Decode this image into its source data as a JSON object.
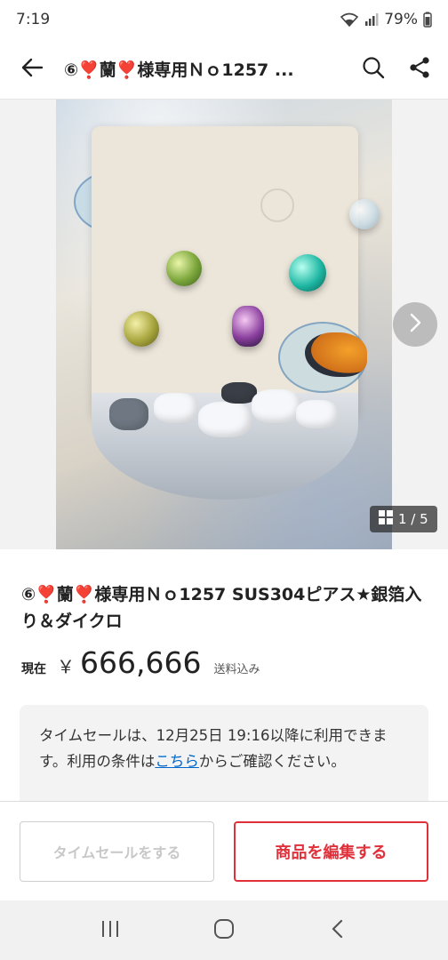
{
  "status_bar": {
    "time": "7:19",
    "battery": "79%",
    "icons": [
      "wifi-icon",
      "signal-icon"
    ]
  },
  "app_bar": {
    "title": "⑥❣️蘭❣️様専用Ｎｏ1257 ...",
    "icons": [
      "back-arrow-icon",
      "search-icon",
      "share-icon"
    ]
  },
  "gallery": {
    "counter": "1 / 5",
    "icons": [
      "grid-icon",
      "chevron-right-icon"
    ]
  },
  "product": {
    "title": "⑥❣️蘭❣️様専用Ｎｏ1257 SUS304ピアス★銀箔入り＆ダイクロ",
    "price_label": "現在",
    "currency": "￥",
    "price": "666,666",
    "shipping": "送料込み"
  },
  "notice": {
    "before": "タイムセールは、12月25日 19:16以降に利用できます。利用の条件は",
    "link": "こちら",
    "after": "からご確認ください。"
  },
  "actions": {
    "timesale": "タイムセールをする",
    "edit": "商品を編集する",
    "colors": {
      "edit": "#e0313b",
      "disabled": "#c8c8c8"
    }
  },
  "system_nav": {
    "icons": [
      "recent-apps-icon",
      "home-icon",
      "back-icon"
    ]
  }
}
